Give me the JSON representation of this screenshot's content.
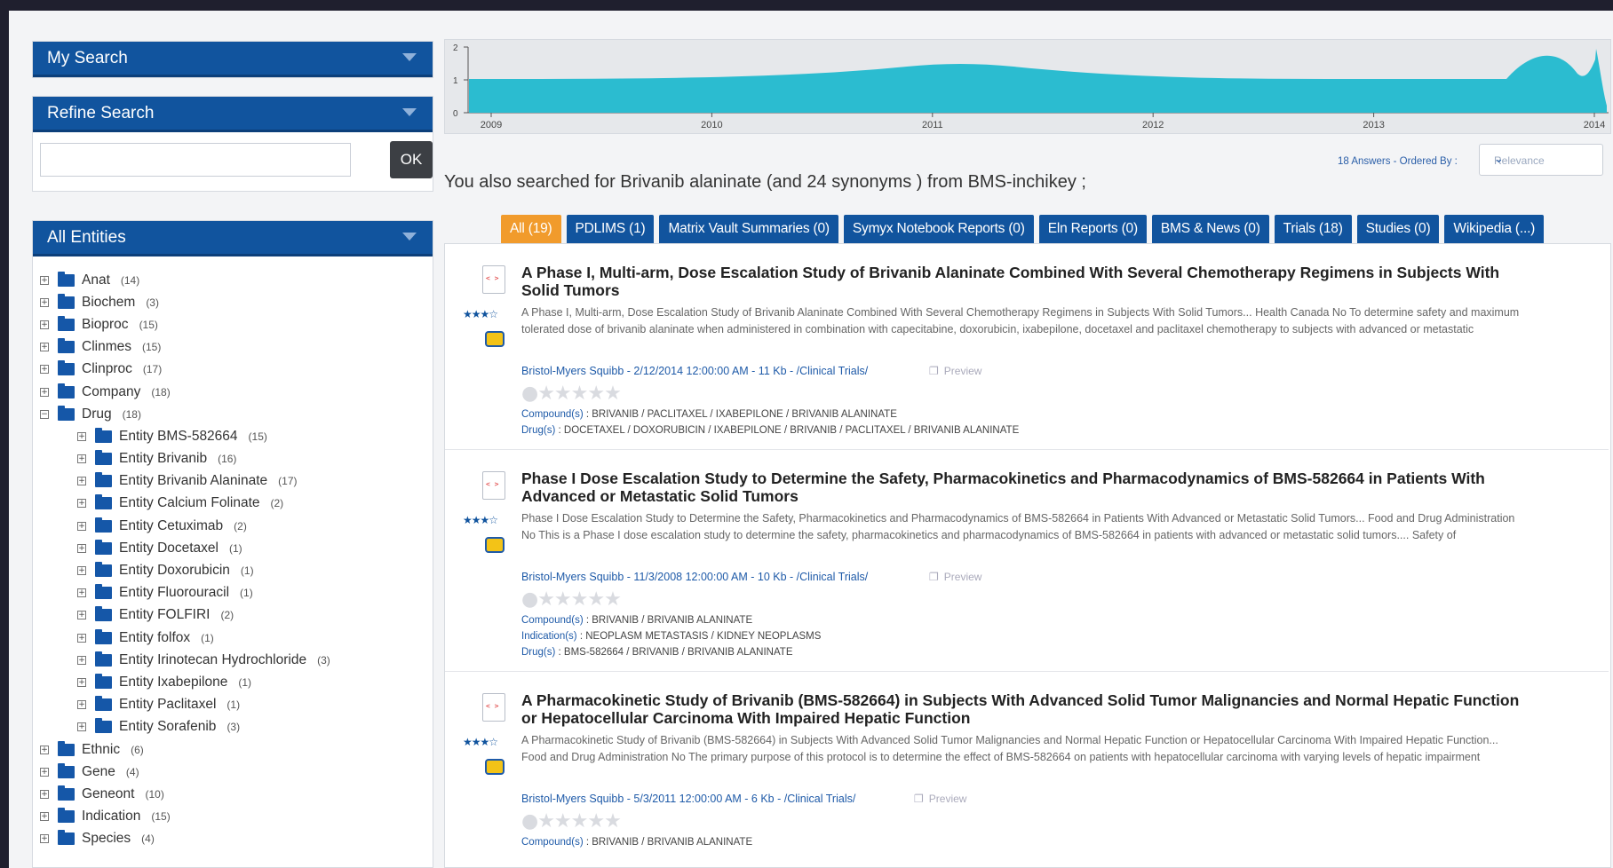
{
  "sidebar": {
    "my_search_label": "My Search",
    "refine_search_label": "Refine Search",
    "refine_input_value": "",
    "ok_label": "OK",
    "all_entities_label": "All Entities",
    "tree": [
      {
        "label": "Anat",
        "count": "(14)",
        "expander": "+",
        "level": 0
      },
      {
        "label": "Biochem",
        "count": "(3)",
        "expander": "+",
        "level": 0
      },
      {
        "label": "Bioproc",
        "count": "(15)",
        "expander": "+",
        "level": 0
      },
      {
        "label": "Clinmes",
        "count": "(15)",
        "expander": "+",
        "level": 0
      },
      {
        "label": "Clinproc",
        "count": "(17)",
        "expander": "+",
        "level": 0
      },
      {
        "label": "Company",
        "count": "(18)",
        "expander": "+",
        "level": 0
      },
      {
        "label": "Drug",
        "count": "(18)",
        "expander": "−",
        "level": 0
      },
      {
        "label": "Entity BMS-582664",
        "count": "(15)",
        "expander": "+",
        "level": 1
      },
      {
        "label": "Entity Brivanib",
        "count": "(16)",
        "expander": "+",
        "level": 1
      },
      {
        "label": "Entity Brivanib Alaninate",
        "count": "(17)",
        "expander": "+",
        "level": 1
      },
      {
        "label": "Entity Calcium Folinate",
        "count": "(2)",
        "expander": "+",
        "level": 1
      },
      {
        "label": "Entity Cetuximab",
        "count": "(2)",
        "expander": "+",
        "level": 1
      },
      {
        "label": "Entity Docetaxel",
        "count": "(1)",
        "expander": "+",
        "level": 1
      },
      {
        "label": "Entity Doxorubicin",
        "count": "(1)",
        "expander": "+",
        "level": 1
      },
      {
        "label": "Entity Fluorouracil",
        "count": "(1)",
        "expander": "+",
        "level": 1
      },
      {
        "label": "Entity FOLFIRI",
        "count": "(2)",
        "expander": "+",
        "level": 1
      },
      {
        "label": "Entity folfox",
        "count": "(1)",
        "expander": "+",
        "level": 1
      },
      {
        "label": "Entity Irinotecan Hydrochloride",
        "count": "(3)",
        "expander": "+",
        "level": 1
      },
      {
        "label": "Entity Ixabepilone",
        "count": "(1)",
        "expander": "+",
        "level": 1
      },
      {
        "label": "Entity Paclitaxel",
        "count": "(1)",
        "expander": "+",
        "level": 1
      },
      {
        "label": "Entity Sorafenib",
        "count": "(3)",
        "expander": "+",
        "level": 1
      },
      {
        "label": "Ethnic",
        "count": "(6)",
        "expander": "+",
        "level": 0
      },
      {
        "label": "Gene",
        "count": "(4)",
        "expander": "+",
        "level": 0
      },
      {
        "label": "Geneont",
        "count": "(10)",
        "expander": "+",
        "level": 0
      },
      {
        "label": "Indication",
        "count": "(15)",
        "expander": "+",
        "level": 0
      },
      {
        "label": "Species",
        "count": "(4)",
        "expander": "+",
        "level": 0
      }
    ]
  },
  "timeline": {
    "y_ticks": [
      "0",
      "1",
      "2"
    ],
    "x_ticks": [
      "2009",
      "2010",
      "2011",
      "2012",
      "2013",
      "2014"
    ],
    "fill_color": "#2bbcd0"
  },
  "search_info": "You also searched for Brivanib alaninate (and 24 synonyms ) from BMS-inchikey ;",
  "order": {
    "label": "18 Answers - Ordered By :",
    "selected": "Relevance"
  },
  "tabs": [
    {
      "label": "All (19)",
      "active": true
    },
    {
      "label": "PDLIMS (1)"
    },
    {
      "label": "Matrix Vault Summaries (0)"
    },
    {
      "label": "Symyx Notebook Reports (0)"
    },
    {
      "label": "Eln Reports (0)"
    },
    {
      "label": "BMS & News (0)"
    },
    {
      "label": "Trials (18)"
    },
    {
      "label": "Studies (0)"
    },
    {
      "label": "Wikipedia (...)"
    }
  ],
  "results": [
    {
      "title": "A Phase I, Multi-arm, Dose Escalation Study of Brivanib Alaninate Combined With Several Chemotherapy Regimens in Subjects With Solid Tumors",
      "snippet": "A Phase I, Multi-arm, Dose Escalation Study of Brivanib Alaninate Combined With Several Chemotherapy Regimens in Subjects With Solid Tumors... Health Canada No To determine safety and maximum tolerated dose of brivanib alaninate when administered in combination with capecitabine, doxorubicin, ixabepilone, docetaxel and paclitaxel chemotherapy to subjects with advanced or metastatic",
      "source": "Bristol-Myers Squibb - 2/12/2014 12:00:00 AM - 11 Kb - /Clinical Trials/",
      "preview": "Preview",
      "meta": [
        {
          "key": "Compound(s)",
          "value": " : BRIVANIB / PACLITAXEL / IXABEPILONE / BRIVANIB ALANINATE"
        },
        {
          "key": "Drug(s)",
          "value": " : DOCETAXEL / DOXORUBICIN / IXABEPILONE / BRIVANIB / PACLITAXEL / BRIVANIB ALANINATE"
        }
      ]
    },
    {
      "title": "Phase I Dose Escalation Study to Determine the Safety, Pharmacokinetics and Pharmacodynamics of BMS-582664 in Patients With Advanced or Metastatic Solid Tumors",
      "snippet": "Phase I Dose Escalation Study to Determine the Safety, Pharmacokinetics and Pharmacodynamics of BMS-582664 in Patients With Advanced or Metastatic Solid Tumors... Food and Drug Administration No This is a Phase I dose escalation study to determine the safety, pharmacokinetics and pharmacodynamics of BMS-582664 in patients with advanced or metastatic solid tumors.... Safety of",
      "source": "Bristol-Myers Squibb - 11/3/2008 12:00:00 AM - 10 Kb - /Clinical Trials/",
      "preview": "Preview",
      "meta": [
        {
          "key": "Compound(s)",
          "value": " : BRIVANIB / BRIVANIB ALANINATE"
        },
        {
          "key": "Indication(s)",
          "value": " : NEOPLASM METASTASIS / KIDNEY NEOPLASMS"
        },
        {
          "key": "Drug(s)",
          "value": " : BMS-582664 / BRIVANIB / BRIVANIB ALANINATE"
        }
      ]
    },
    {
      "title": "A Pharmacokinetic Study of Brivanib (BMS-582664) in Subjects With Advanced Solid Tumor Malignancies and Normal Hepatic Function or Hepatocellular Carcinoma With Impaired Hepatic Function",
      "snippet": "A Pharmacokinetic Study of Brivanib (BMS-582664) in Subjects With Advanced Solid Tumor Malignancies and Normal Hepatic Function or Hepatocellular Carcinoma With Impaired Hepatic Function... Food and Drug Administration No The primary purpose of this protocol is to determine the effect of BMS-582664 on patients with hepatocellular carcinoma with varying levels of hepatic impairment",
      "source": "Bristol-Myers Squibb - 5/3/2011 12:00:00 AM - 6 Kb - /Clinical Trials/",
      "preview": "Preview",
      "meta": [
        {
          "key": "Compound(s)",
          "value": " : BRIVANIB / BRIVANIB ALANINATE"
        }
      ]
    }
  ]
}
